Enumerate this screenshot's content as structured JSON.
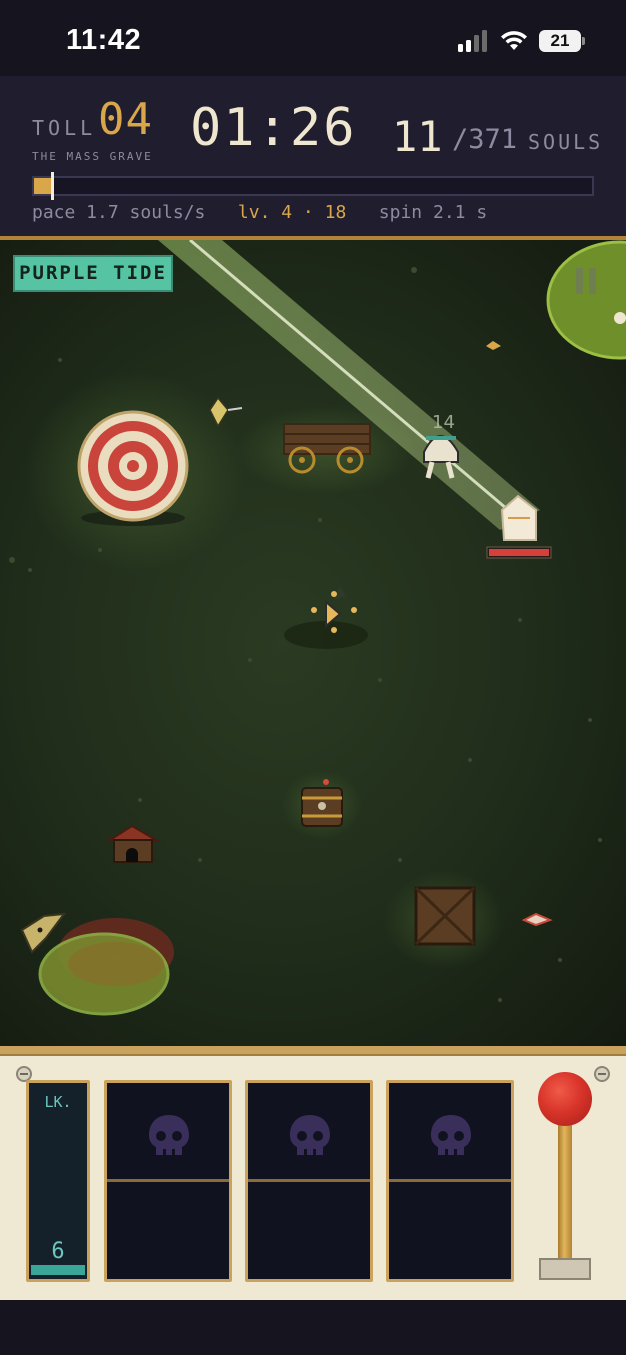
{
  "status_bar": {
    "time": "11:42",
    "battery": "21",
    "icons": [
      "signal-icon",
      "wifi-icon",
      "battery-icon"
    ]
  },
  "hud": {
    "toll_label": "TOLL",
    "toll_value": "04",
    "stage_name": "THE MASS GRAVE",
    "timer": "01:26",
    "souls_current": "11",
    "souls_total": "/371",
    "souls_label": "SOULS",
    "progress_fraction": 0.03,
    "pace": "pace 1.7 souls/s",
    "level": "lv. 4 · 18",
    "spin": "spin 2.1 s"
  },
  "field": {
    "wave_name": "PURPLE TIDE",
    "enemy_hp_label": "14",
    "enemy_hp_fraction": 1.0,
    "entities": [
      "archery-target",
      "wooden-cart",
      "ghost-enemy",
      "boss-enemy",
      "player-character",
      "soul-shard",
      "lantern-barrel",
      "doghouse",
      "wooden-crate",
      "blood-pool",
      "bird-enemy",
      "pause-icon"
    ]
  },
  "panel": {
    "luck_label": "LK.",
    "luck_value": "6",
    "luck_fraction": 0.05,
    "reels": [
      {
        "icon": "skull-icon"
      },
      {
        "icon": "skull-icon"
      },
      {
        "icon": "skull-icon"
      }
    ],
    "lever_icon": "lever-knob",
    "colors": {
      "accent_gold": "#d9a64a",
      "wave_badge": "#56c4a3",
      "lever_red": "#d8342a",
      "reel_skull": "#3a2f5a"
    }
  }
}
